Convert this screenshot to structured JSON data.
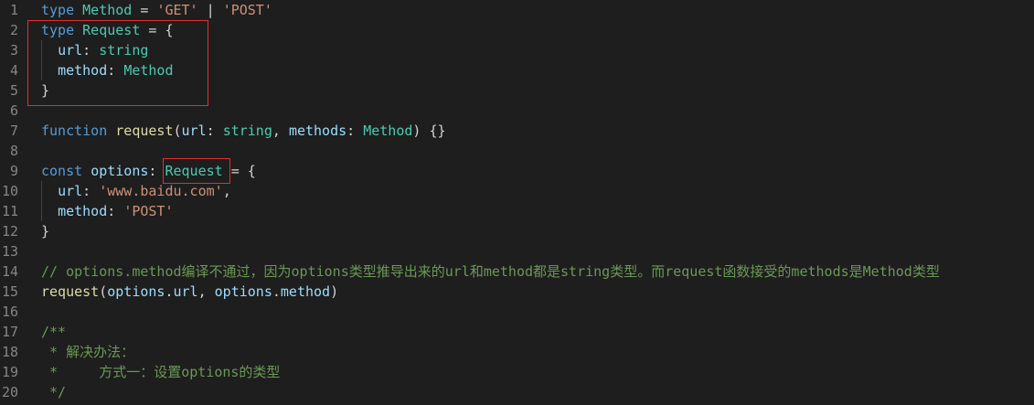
{
  "lines": [
    {
      "n": "1",
      "tokens": [
        {
          "t": "type",
          "c": "kw"
        },
        {
          "t": " "
        },
        {
          "t": "Method",
          "c": "ty"
        },
        {
          "t": " = "
        },
        {
          "t": "'GET'",
          "c": "str"
        },
        {
          "t": " | "
        },
        {
          "t": "'POST'",
          "c": "str"
        }
      ]
    },
    {
      "n": "2",
      "tokens": [
        {
          "t": "type",
          "c": "kw"
        },
        {
          "t": " "
        },
        {
          "t": "Request",
          "c": "ty"
        },
        {
          "t": " = {"
        }
      ]
    },
    {
      "n": "3",
      "tokens": [
        {
          "t": "  "
        },
        {
          "t": "url",
          "c": "var"
        },
        {
          "t": ": "
        },
        {
          "t": "string",
          "c": "ty"
        }
      ]
    },
    {
      "n": "4",
      "tokens": [
        {
          "t": "  "
        },
        {
          "t": "method",
          "c": "var"
        },
        {
          "t": ": "
        },
        {
          "t": "Method",
          "c": "ty"
        }
      ]
    },
    {
      "n": "5",
      "tokens": [
        {
          "t": "}"
        }
      ]
    },
    {
      "n": "6",
      "tokens": []
    },
    {
      "n": "7",
      "tokens": [
        {
          "t": "function",
          "c": "kw"
        },
        {
          "t": " "
        },
        {
          "t": "request",
          "c": "fn"
        },
        {
          "t": "("
        },
        {
          "t": "url",
          "c": "var"
        },
        {
          "t": ": "
        },
        {
          "t": "string",
          "c": "ty"
        },
        {
          "t": ", "
        },
        {
          "t": "methods",
          "c": "var"
        },
        {
          "t": ": "
        },
        {
          "t": "Method",
          "c": "ty"
        },
        {
          "t": ") {}"
        }
      ]
    },
    {
      "n": "8",
      "tokens": []
    },
    {
      "n": "9",
      "tokens": [
        {
          "t": "const",
          "c": "kw"
        },
        {
          "t": " "
        },
        {
          "t": "options",
          "c": "var"
        },
        {
          "t": ": "
        },
        {
          "t": "Request",
          "c": "ty"
        },
        {
          "t": " = {"
        }
      ]
    },
    {
      "n": "10",
      "tokens": [
        {
          "t": "  "
        },
        {
          "t": "url",
          "c": "var"
        },
        {
          "t": ": "
        },
        {
          "t": "'www.baidu.com'",
          "c": "str"
        },
        {
          "t": ","
        }
      ]
    },
    {
      "n": "11",
      "tokens": [
        {
          "t": "  "
        },
        {
          "t": "method",
          "c": "var"
        },
        {
          "t": ": "
        },
        {
          "t": "'POST'",
          "c": "str"
        }
      ]
    },
    {
      "n": "12",
      "tokens": [
        {
          "t": "}"
        }
      ]
    },
    {
      "n": "13",
      "tokens": []
    },
    {
      "n": "14",
      "tokens": [
        {
          "t": "// options.method编译不通过，因为options类型推导出来的url和method都是string类型。而request函数接受的methods是Method类型",
          "c": "cm"
        }
      ]
    },
    {
      "n": "15",
      "tokens": [
        {
          "t": "request",
          "c": "fn"
        },
        {
          "t": "("
        },
        {
          "t": "options",
          "c": "var"
        },
        {
          "t": "."
        },
        {
          "t": "url",
          "c": "var"
        },
        {
          "t": ", "
        },
        {
          "t": "options",
          "c": "var"
        },
        {
          "t": "."
        },
        {
          "t": "method",
          "c": "var"
        },
        {
          "t": ")"
        }
      ]
    },
    {
      "n": "16",
      "tokens": []
    },
    {
      "n": "17",
      "tokens": [
        {
          "t": "/**",
          "c": "cm"
        }
      ]
    },
    {
      "n": "18",
      "tokens": [
        {
          "t": " * 解决办法：",
          "c": "cm"
        }
      ]
    },
    {
      "n": "19",
      "tokens": [
        {
          "t": " *     方式一：设置options的类型",
          "c": "cm"
        }
      ]
    },
    {
      "n": "20",
      "tokens": [
        {
          "t": " */",
          "c": "cm"
        }
      ]
    }
  ],
  "colors": {
    "background": "#1e1e1e",
    "keyword": "#569cd6",
    "type": "#4ec9b0",
    "string": "#ce9178",
    "variable": "#9cdcfe",
    "function": "#dcdcaa",
    "comment": "#6a9955",
    "highlight": "#e03030"
  }
}
